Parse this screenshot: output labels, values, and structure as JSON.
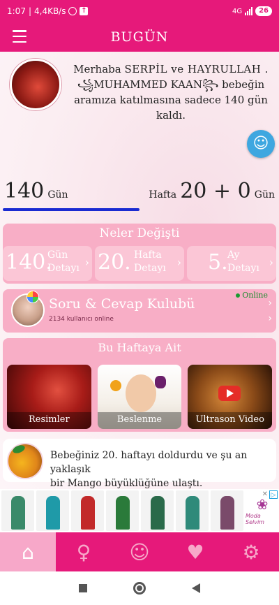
{
  "status_bar": {
    "time": "1:07",
    "net_speed": "4,4KB/s",
    "network": "4G",
    "battery": "26"
  },
  "header": {
    "title": "BUGÜN"
  },
  "welcome": {
    "line1_prefix": "Merhaba ",
    "names": "SERPİL ve HAYRULLAH .",
    "baby": "꧁MUHAMMED KAAN꧂",
    "line2_suffix": " bebeğin",
    "line3": "aramıza katılmasına sadece 140 gün",
    "line4": "kaldı."
  },
  "counters": {
    "days_value": "140",
    "days_label": "Gün",
    "week_label": "Hafta",
    "week_value": "20 + 0",
    "week_days_label": "Gün",
    "progress_fraction": 0.5
  },
  "neler": {
    "title": "Neler Değişti",
    "tiles": [
      {
        "num": "140.",
        "line1": "Gün",
        "line2": "Detayı"
      },
      {
        "num": "20.",
        "line1": "Hafta",
        "line2": "Detayı"
      },
      {
        "num": "5.",
        "line1": "Ay",
        "line2": "Detayı"
      }
    ]
  },
  "soru": {
    "title": "Soru & Cevap Kulubü",
    "subtitle": "2134 kullanıcı online",
    "online": "Online"
  },
  "hafta": {
    "title": "Bu Haftaya Ait",
    "cards": [
      {
        "label": "Resimler"
      },
      {
        "label": "Beslenme"
      },
      {
        "label": "Ultrason Video"
      }
    ]
  },
  "mango": {
    "text_line1": "Bebeğiniz 20. haftayı doldurdu ve şu an yaklaşık",
    "text_line2": "bir Mango büyüklüğüne ulaştı."
  },
  "ad": {
    "brand": "Moda Selvim",
    "dress_colors": [
      "#3a8a6a",
      "#1f9aa8",
      "#c22a2a",
      "#2a7a3a",
      "#2a6a4a",
      "#2f8a7a",
      "#7a4a6a"
    ]
  },
  "bottom_nav": {
    "items": [
      "home-icon",
      "stroller-icon",
      "baby-icon",
      "heartbeat-icon",
      "settings-icon"
    ]
  },
  "colors": {
    "brand": "#e6197a",
    "panel": "#f8aec6",
    "progress": "#1a2bd1"
  }
}
